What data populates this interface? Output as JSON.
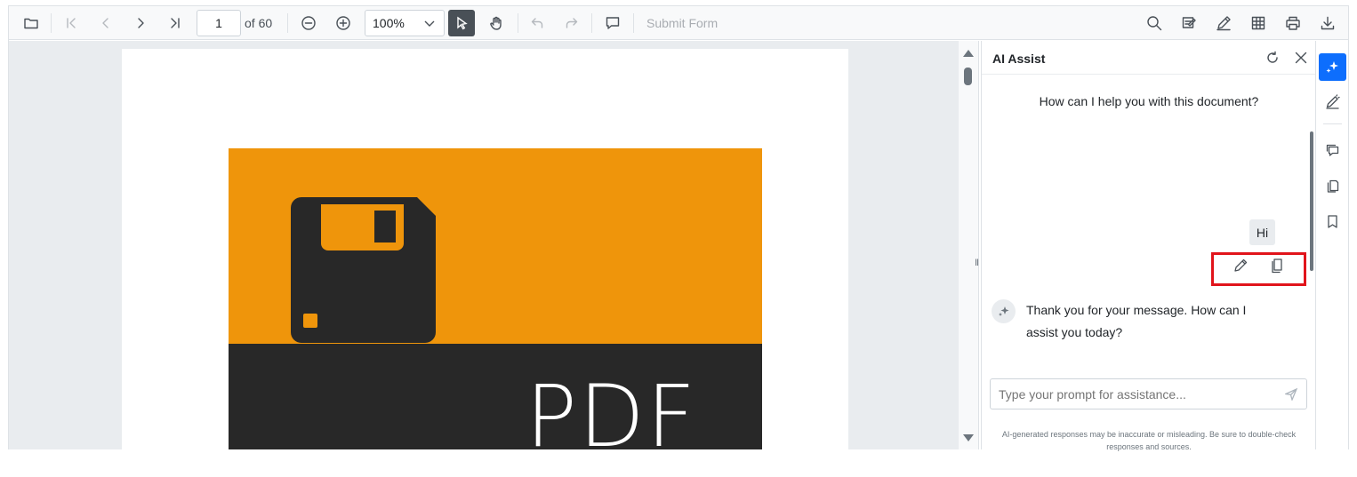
{
  "toolbar": {
    "current_page": "1",
    "page_count_label": "of 60",
    "zoom_value": "100%",
    "submit_form_label": "Submit Form",
    "selected_tool_color": "#495057"
  },
  "document": {
    "cover_text": "PDF",
    "cover_colors": {
      "accent": "#ef950b",
      "dark": "#282828"
    }
  },
  "ai_panel": {
    "title": "AI Assist",
    "welcome_message": "How can I help you with this document?",
    "user_message": "Hi",
    "assistant_message": "Thank you for your message. How can I assist you today?",
    "prompt_placeholder": "Type your prompt for assistance...",
    "disclaimer": "AI-generated responses may be inaccurate or misleading. Be sure to double-check responses and sources.",
    "highlight_color": "#e1141b",
    "icons": [
      "refresh-icon",
      "close-icon",
      "edit-icon",
      "copy-icon",
      "sparkle-icon",
      "send-icon"
    ]
  },
  "right_rail": {
    "active_color": "#0d6efd",
    "items": [
      "ai-assist-icon",
      "form-designer-icon",
      "comments-icon",
      "thumbnails-icon",
      "bookmarks-icon"
    ]
  },
  "toolbar_icons": [
    "folder-open-icon",
    "first-page-icon",
    "previous-page-icon",
    "next-page-icon",
    "last-page-icon",
    "zoom-out-icon",
    "zoom-in-icon",
    "select-cursor-icon",
    "pan-hand-icon",
    "undo-icon",
    "redo-icon",
    "comment-icon",
    "search-icon",
    "annotation-icon",
    "edit-pen-icon",
    "form-fields-icon",
    "print-icon",
    "download-icon"
  ]
}
